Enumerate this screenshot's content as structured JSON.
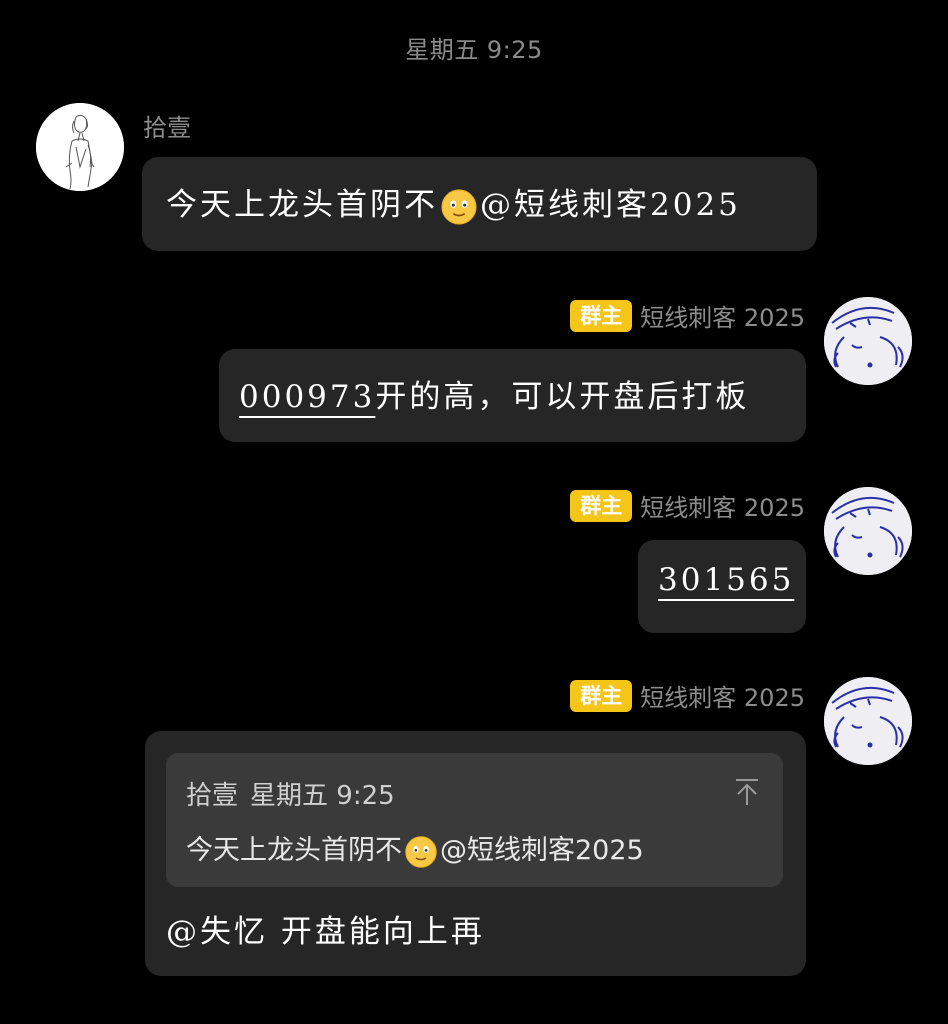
{
  "chat": {
    "timestamp": "星期五 9:25",
    "messages": [
      {
        "sender": "拾壹",
        "text_before_emoji": "今天上龙头首阴不",
        "emoji": "smiling-face-emoji",
        "text_after_emoji": "@短线刺客2025"
      },
      {
        "sender": "短线刺客 2025",
        "badge": "群主",
        "stock_code": "000973",
        "text": "开的高，可以开盘后打板"
      },
      {
        "sender": "短线刺客 2025",
        "badge": "群主",
        "stock_code": "301565"
      },
      {
        "sender": "短线刺客 2025",
        "badge": "群主",
        "quote": {
          "sender": "拾壹",
          "time": "星期五 9:25",
          "text_before_emoji": "今天上龙头首阴不",
          "text_after_emoji": "@短线刺客2025"
        },
        "text": "@失忆 开盘能向上再"
      }
    ]
  },
  "colors": {
    "background": "#000000",
    "bubble": "#262626",
    "quote_background": "#3a3a3a",
    "badge": "#f5c518",
    "meta_text": "#8c8c8c"
  },
  "icons": {
    "left_avatar": "sketch-avatar",
    "right_avatar": "doodle-avatar",
    "collapse": "collapse-to-top-icon"
  }
}
